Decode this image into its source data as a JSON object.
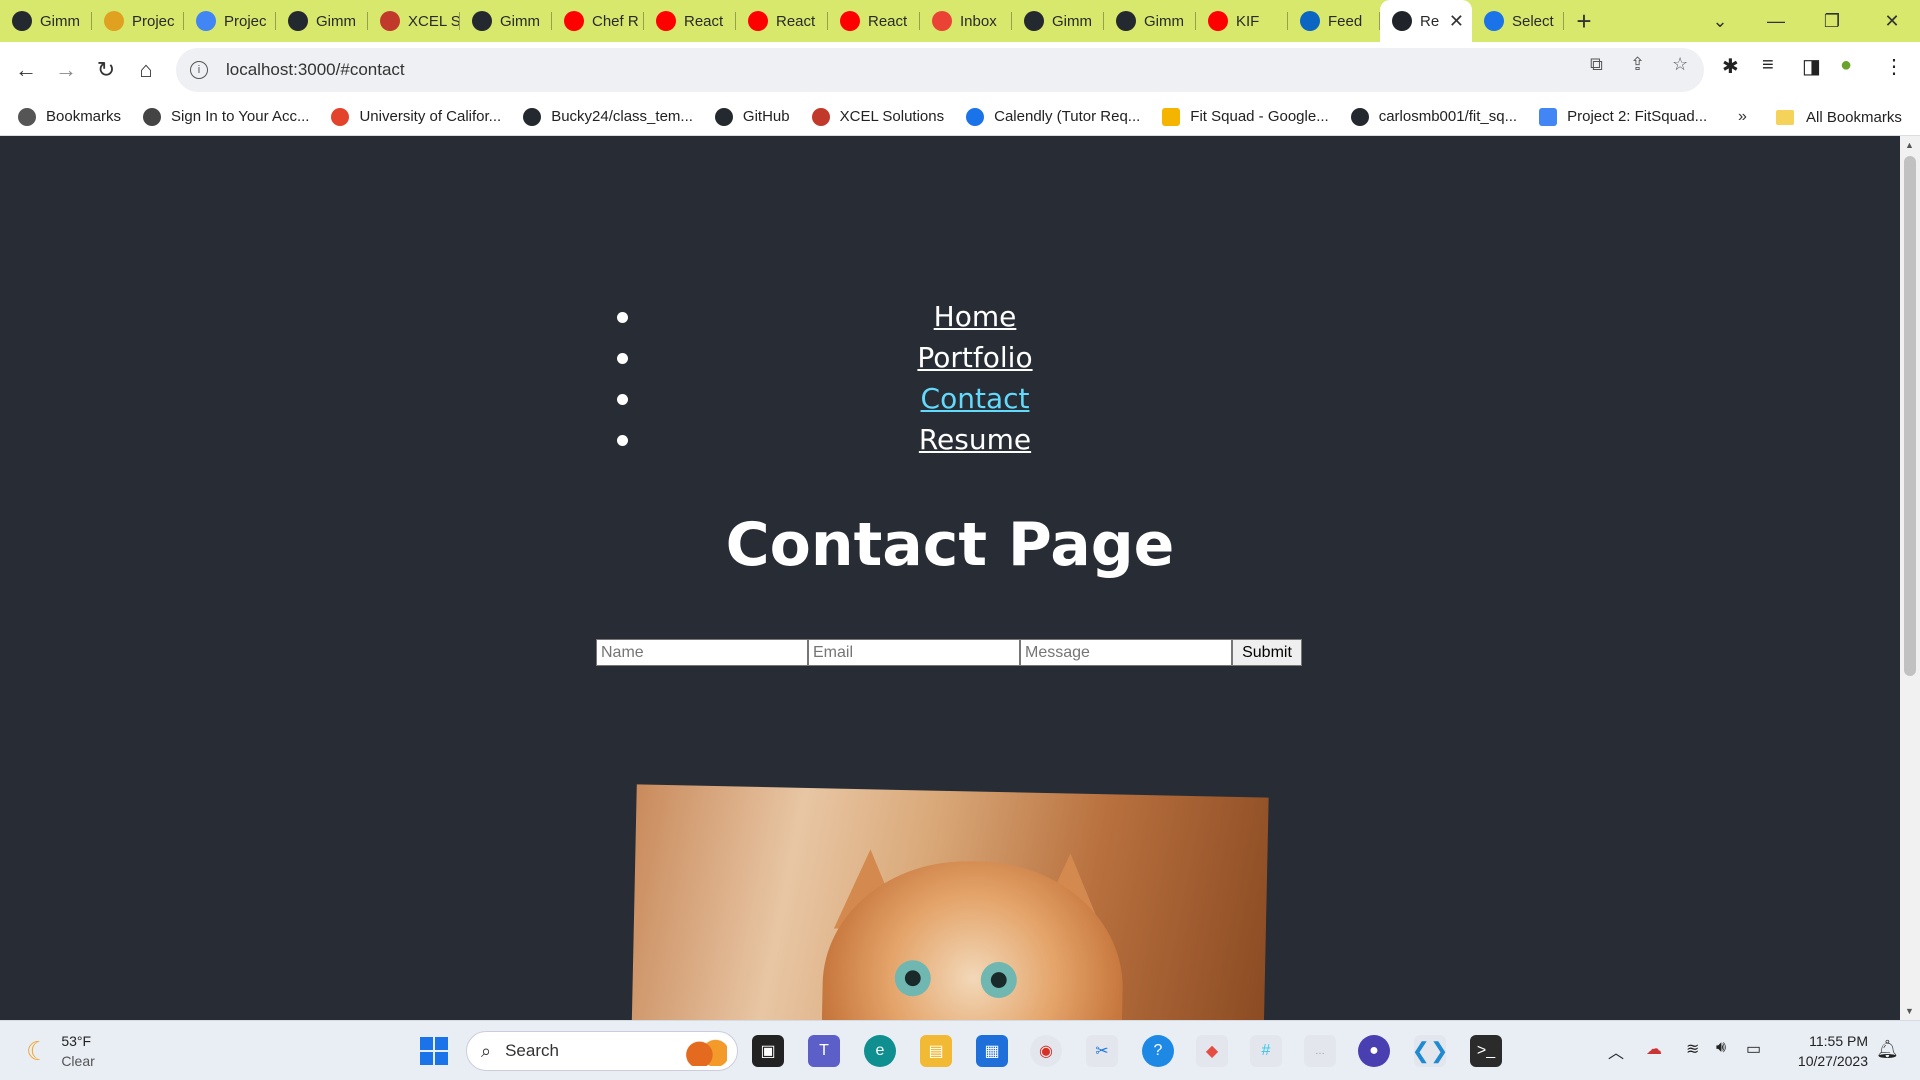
{
  "browser": {
    "tabs": [
      {
        "label": "Gimm",
        "icon": "github-icon",
        "color": "#24292f"
      },
      {
        "label": "Projec",
        "icon": "trello-icon",
        "color": "#e0a020"
      },
      {
        "label": "Projec",
        "icon": "docs-icon",
        "color": "#4285f4"
      },
      {
        "label": "Gimm",
        "icon": "github-icon",
        "color": "#24292f"
      },
      {
        "label": "XCEL S",
        "icon": "xcel-icon",
        "color": "#c0392b"
      },
      {
        "label": "Gimm",
        "icon": "github-icon",
        "color": "#24292f"
      },
      {
        "label": "Chef R",
        "icon": "youtube-icon",
        "color": "#ff0000"
      },
      {
        "label": "React",
        "icon": "youtube-icon",
        "color": "#ff0000"
      },
      {
        "label": "React",
        "icon": "youtube-icon",
        "color": "#ff0000"
      },
      {
        "label": "React",
        "icon": "youtube-icon",
        "color": "#ff0000"
      },
      {
        "label": "Inbox",
        "icon": "gmail-icon",
        "color": "#ea4335"
      },
      {
        "label": "Gimm",
        "icon": "github-icon",
        "color": "#24292f"
      },
      {
        "label": "Gimm",
        "icon": "github-icon",
        "color": "#24292f"
      },
      {
        "label": "KIF",
        "icon": "youtube-icon",
        "color": "#ff0000"
      },
      {
        "label": "Feed",
        "icon": "linkedin-icon",
        "color": "#0a66c2"
      },
      {
        "label": "Re",
        "icon": "react-icon",
        "color": "#20232a",
        "active": true
      },
      {
        "label": "Select",
        "icon": "chrome-icon",
        "color": "#1a73e8"
      }
    ],
    "new_tab": "+",
    "url": "localhost:3000/#contact",
    "bookmarks": [
      {
        "label": "Bookmarks",
        "icon": "star-icon"
      },
      {
        "label": "Sign In to Your Acc...",
        "icon": "globe-icon"
      },
      {
        "label": "University of Califor...",
        "icon": "gitlab-icon"
      },
      {
        "label": "Bucky24/class_tem...",
        "icon": "github-icon"
      },
      {
        "label": "GitHub",
        "icon": "github-icon"
      },
      {
        "label": "XCEL Solutions",
        "icon": "xcel-icon"
      },
      {
        "label": "Calendly (Tutor Req...",
        "icon": "calendly-icon"
      },
      {
        "label": "Fit Squad - Google...",
        "icon": "slides-icon"
      },
      {
        "label": "carlosmb001/fit_sq...",
        "icon": "github-icon"
      },
      {
        "label": "Project 2: FitSquad...",
        "icon": "docs-icon"
      }
    ],
    "bookmarks_more": "»",
    "all_bookmarks": "All Bookmarks"
  },
  "page": {
    "nav": [
      {
        "label": "Home",
        "current": false
      },
      {
        "label": "Portfolio",
        "current": false
      },
      {
        "label": "Contact",
        "current": true
      },
      {
        "label": "Resume",
        "current": false
      }
    ],
    "title": "Contact Page",
    "form": {
      "name_placeholder": "Name",
      "email_placeholder": "Email",
      "message_placeholder": "Message",
      "submit_label": "Submit"
    },
    "colors": {
      "background": "#282c34",
      "link": "#ffffff",
      "active_link": "#61dafb"
    }
  },
  "taskbar": {
    "weather_temp": "53°F",
    "weather_desc": "Clear",
    "search_label": "Search",
    "time": "11:55 PM",
    "date": "10/27/2023"
  }
}
